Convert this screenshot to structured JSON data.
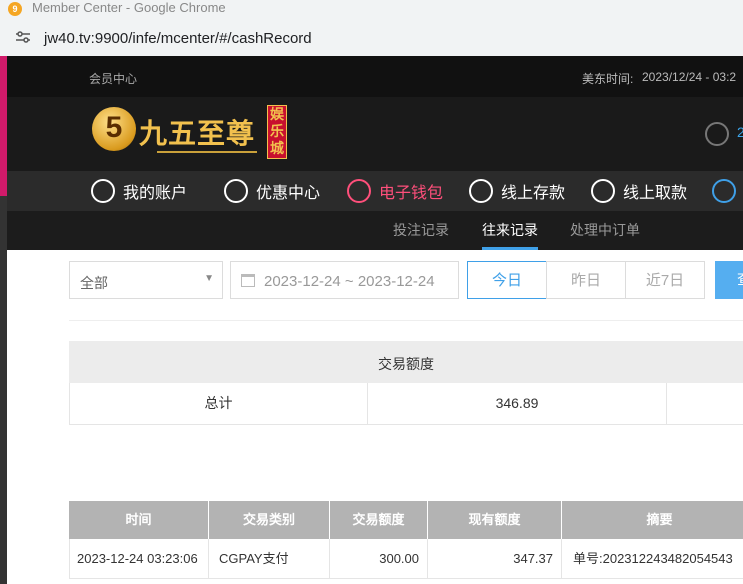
{
  "browser": {
    "window_title": "Member Center - Google Chrome",
    "url": "jw40.tv:9900/infe/mcenter/#/cashRecord"
  },
  "topbar": {
    "member_center": "会员中心",
    "time_label": "美东时间:",
    "time_value": "2023/12/24 - 03:2"
  },
  "header": {
    "logo_mark": "5",
    "logo_text": "九五至尊",
    "logo_sub": "娱乐城",
    "user_num": "2"
  },
  "nav": {
    "items": [
      {
        "label": "我的账户",
        "icon": "user-icon"
      },
      {
        "label": "优惠中心",
        "icon": "gift-icon"
      },
      {
        "label": "电子钱包",
        "icon": "wallet-icon",
        "active": true
      },
      {
        "label": "线上存款",
        "icon": "deposit-icon"
      },
      {
        "label": "线上取款",
        "icon": "withdraw-icon"
      }
    ]
  },
  "subnav": {
    "tabs": [
      "投注记录",
      "往来记录",
      "处理中订单"
    ],
    "active": "往来记录"
  },
  "filters": {
    "type_select": "全部",
    "date_range": "2023-12-24 ~ 2023-12-24",
    "quick": [
      "今日",
      "昨日",
      "近7日"
    ],
    "active_quick": "今日",
    "search_label": "查"
  },
  "summary": {
    "header": "交易额度",
    "row_label": "总计",
    "row_value": "346.89"
  },
  "table": {
    "columns": [
      "时间",
      "交易类别",
      "交易额度",
      "现有额度",
      "摘要"
    ],
    "rows": [
      {
        "time": "2023-12-24 03:23:06",
        "type": "CGPAY支付",
        "amount": "300.00",
        "balance": "347.37",
        "memo": "单号:202312243482054543"
      }
    ]
  },
  "colors": {
    "accent_blue": "#3fa0e8",
    "active_nav": "#ff4f7b",
    "gold": "#f2c14e"
  }
}
